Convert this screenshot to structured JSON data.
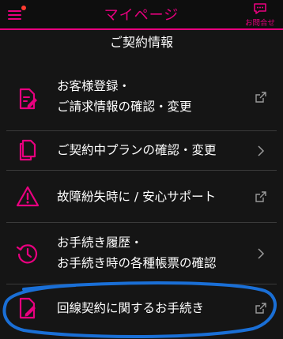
{
  "header": {
    "title": "マイページ",
    "menu_icon": "hamburger-menu-icon",
    "contact_label": "お問合せ",
    "contact_icon": "chat-bubble-icon"
  },
  "section": {
    "title": "ご契約情報"
  },
  "items": [
    {
      "line1": "お客様登録・",
      "line2": "ご請求情報の確認・変更",
      "icon": "document-edit-icon",
      "trail": "external-link-icon"
    },
    {
      "line1": "ご契約中プランの確認・変更",
      "icon": "documents-copy-icon",
      "trail": "chevron-right-icon"
    },
    {
      "line1": "故障紛失時に / 安心サポート",
      "icon": "warning-triangle-icon",
      "trail": "external-link-icon"
    },
    {
      "line1": "お手続き履歴・",
      "line2": "お手続き時の各種帳票の確認",
      "icon": "history-clock-icon",
      "trail": "chevron-right-icon"
    },
    {
      "line1": "回線契約に関するお手続き",
      "icon": "document-pen-icon",
      "trail": "external-link-icon"
    }
  ],
  "colors": {
    "accent": "#e8007f",
    "background": "#151515",
    "annotation": "#1a6fd6"
  }
}
